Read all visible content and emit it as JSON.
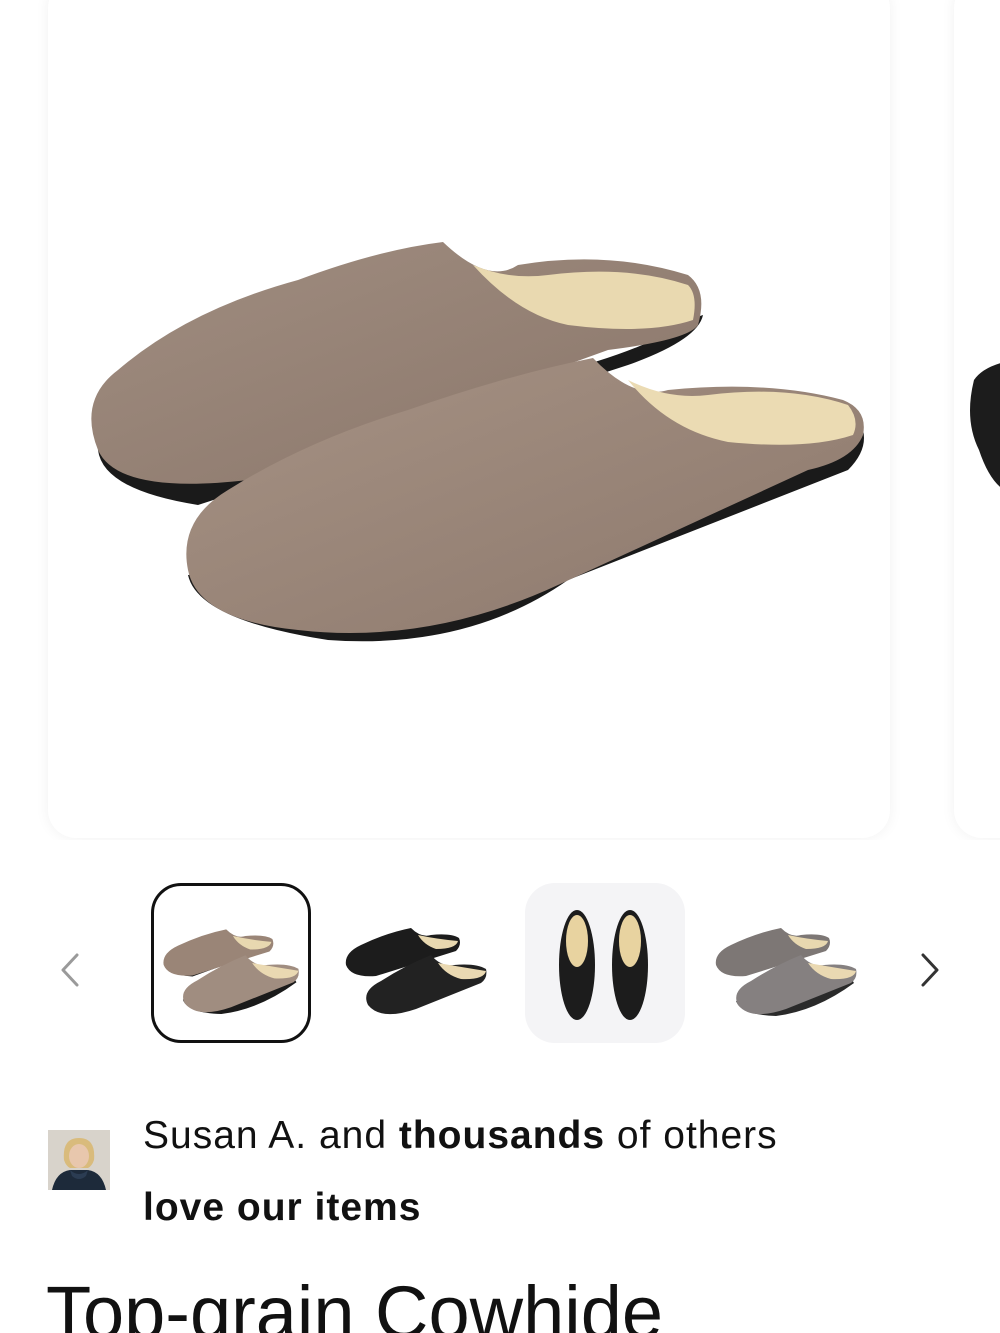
{
  "gallery": {
    "main_image": "brown suede clog slippers",
    "next_image": "black suede clog slipper (partially visible)"
  },
  "thumbnails": {
    "prev_icon": "chevron-left-icon",
    "next_icon": "chevron-right-icon",
    "items": [
      {
        "label": "taupe suede clogs",
        "color": "#9a8577",
        "selected": true
      },
      {
        "label": "black suede clogs",
        "color": "#1c1c1c",
        "selected": false
      },
      {
        "label": "black clogs top view",
        "color": "#1c1c1c",
        "selected": false
      },
      {
        "label": "grey suede clogs",
        "color": "#7d7775",
        "selected": false
      }
    ]
  },
  "social_proof": {
    "name": "Susan A. and",
    "emphasis": "thousands",
    "tail": "of others",
    "line2": "love our items"
  },
  "product": {
    "title": "Top-grain Cowhide"
  },
  "colors": {
    "suede_taupe": "#9a8577",
    "insole": "#e8d8b0",
    "sole": "#1a1a1a"
  }
}
